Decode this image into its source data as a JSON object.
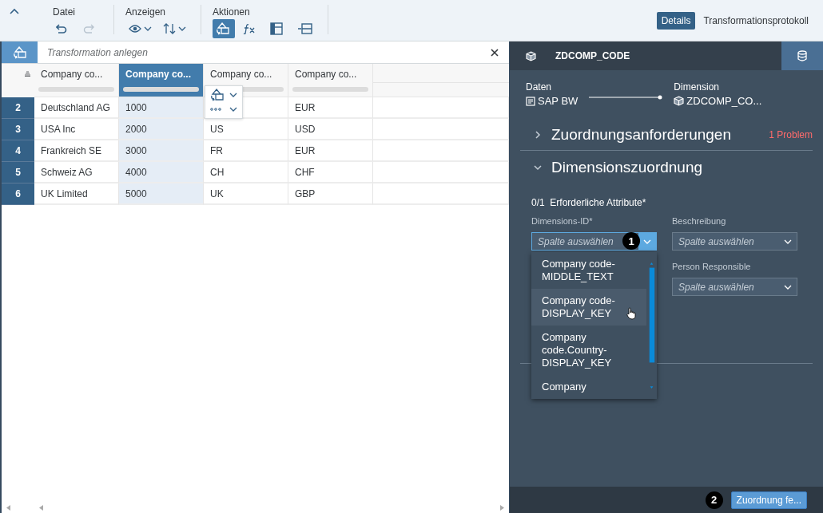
{
  "toolbar": {
    "groups": [
      {
        "label": "Datei",
        "tools": [
          {
            "kind": "undo",
            "selected": false,
            "disabled": false,
            "menu": false
          },
          {
            "kind": "redo",
            "selected": false,
            "disabled": true,
            "menu": false
          }
        ]
      },
      {
        "label": "Anzeigen",
        "tools": [
          {
            "kind": "view",
            "selected": false,
            "disabled": false,
            "menu": true
          },
          {
            "kind": "sort",
            "selected": false,
            "disabled": false,
            "menu": true
          }
        ]
      },
      {
        "label": "Aktionen",
        "tools": [
          {
            "kind": "transform",
            "selected": true,
            "disabled": false,
            "menu": false
          },
          {
            "kind": "formula",
            "selected": false,
            "disabled": false,
            "menu": false
          },
          {
            "kind": "split",
            "selected": false,
            "disabled": false,
            "menu": false
          },
          {
            "kind": "merge",
            "selected": false,
            "disabled": false,
            "menu": false
          }
        ]
      }
    ],
    "tabs": [
      {
        "label": "Details",
        "selected": true
      },
      {
        "label": "Transformationsprotokoll",
        "selected": false
      }
    ]
  },
  "transform_bar": {
    "placeholder": "Transformation anlegen"
  },
  "grid": {
    "columns": [
      {
        "label": "Company co...",
        "selected": false
      },
      {
        "label": "Company co...",
        "selected": true
      },
      {
        "label": "Company co...",
        "selected": false
      },
      {
        "label": "Company co...",
        "selected": false
      }
    ],
    "rows": [
      {
        "number": "2",
        "cells": [
          "Deutschland AG",
          "1000",
          null,
          "EUR"
        ]
      },
      {
        "number": "3",
        "cells": [
          "USA Inc",
          "2000",
          "US",
          "USD"
        ]
      },
      {
        "number": "4",
        "cells": [
          "Frankreich SE",
          "3000",
          "FR",
          "EUR"
        ]
      },
      {
        "number": "5",
        "cells": [
          "Schweiz AG",
          "4000",
          "CH",
          "CHF"
        ]
      },
      {
        "number": "6",
        "cells": [
          "UK Limited",
          "5000",
          "UK",
          "GBP"
        ]
      }
    ],
    "column_menu": {
      "items": [
        {
          "kind": "transform"
        },
        {
          "kind": "more"
        }
      ]
    }
  },
  "details": {
    "title": "ZDCOMP_CODE",
    "flow": {
      "source": {
        "label": "Daten",
        "value": "SAP BW"
      },
      "target": {
        "label": "Dimension",
        "value": "ZDCOMP_CO..."
      }
    },
    "sections": [
      {
        "title": "Zuordnungsanforderungen",
        "expanded": false,
        "issue": "1 Problem"
      },
      {
        "title": "Dimensionszuordnung",
        "expanded": true
      }
    ],
    "mapping": {
      "count": "0/1",
      "title": "Erforderliche Attribute*",
      "fields": [
        {
          "label": "Dimensions-ID*",
          "placeholder": "Spalte auswählen",
          "open": true,
          "step": "1"
        },
        {
          "label": "Beschreibung",
          "placeholder": "Spalte auswählen",
          "open": false
        },
        {
          "label": "Person Responsible",
          "placeholder": "Spalte auswählen",
          "open": false
        }
      ],
      "options": [
        {
          "label": "Company code-MIDDLE_TEXT",
          "hovered": false
        },
        {
          "label": "Company code-DISPLAY_KEY",
          "hovered": true
        },
        {
          "label": "Company code.Country-DISPLAY_KEY",
          "hovered": false
        },
        {
          "label": "Company",
          "hovered": false
        }
      ]
    },
    "footer": {
      "step": "2",
      "button": "Zuordnung fe..."
    }
  }
}
